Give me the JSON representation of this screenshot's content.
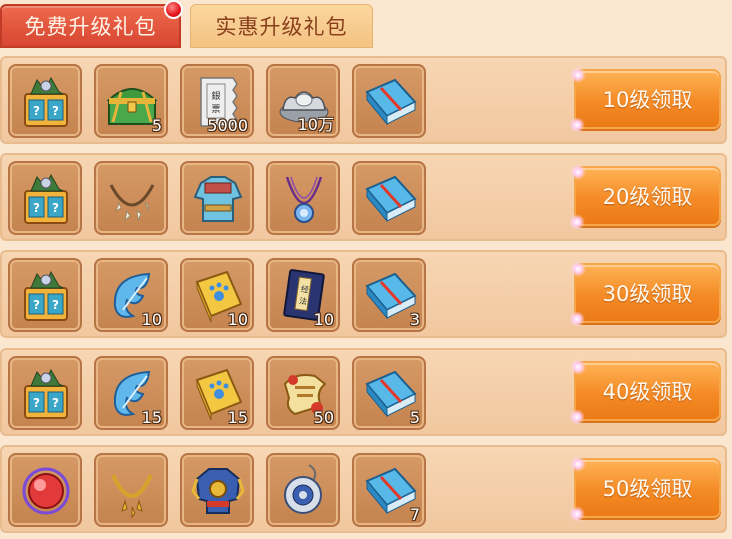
{
  "tabs": {
    "free": "免费升级礼包",
    "discount": "实惠升级礼包"
  },
  "rows": [
    {
      "claim": "10级领取",
      "items": [
        {
          "icon": "mystery-chest-icon",
          "qty": ""
        },
        {
          "icon": "green-treasure-chest-icon",
          "qty": "5"
        },
        {
          "icon": "banknote-icon",
          "qty": "5000"
        },
        {
          "icon": "silver-ingot-icon",
          "qty": "10万"
        },
        {
          "icon": "blue-book-icon",
          "qty": ""
        }
      ]
    },
    {
      "claim": "20级领取",
      "items": [
        {
          "icon": "mystery-chest-icon",
          "qty": ""
        },
        {
          "icon": "tooth-necklace-icon",
          "qty": ""
        },
        {
          "icon": "armor-icon",
          "qty": ""
        },
        {
          "icon": "pendant-icon",
          "qty": ""
        },
        {
          "icon": "blue-book-icon",
          "qty": ""
        }
      ]
    },
    {
      "claim": "30级领取",
      "items": [
        {
          "icon": "mystery-chest-icon",
          "qty": ""
        },
        {
          "icon": "blue-feather-icon",
          "qty": "10"
        },
        {
          "icon": "paw-book-icon",
          "qty": "10"
        },
        {
          "icon": "scripture-book-icon",
          "qty": "10"
        },
        {
          "icon": "blue-book-icon",
          "qty": "3"
        }
      ]
    },
    {
      "claim": "40级领取",
      "items": [
        {
          "icon": "mystery-chest-icon",
          "qty": ""
        },
        {
          "icon": "blue-feather-icon",
          "qty": "15"
        },
        {
          "icon": "paw-book-icon",
          "qty": "15"
        },
        {
          "icon": "scroll-icon",
          "qty": "50"
        },
        {
          "icon": "blue-book-icon",
          "qty": "5"
        }
      ]
    },
    {
      "claim": "50级领取",
      "items": [
        {
          "icon": "red-orb-icon",
          "qty": ""
        },
        {
          "icon": "gold-necklace-icon",
          "qty": ""
        },
        {
          "icon": "ornate-armor-icon",
          "qty": ""
        },
        {
          "icon": "jade-medallion-icon",
          "qty": ""
        },
        {
          "icon": "blue-book-icon",
          "qty": "7"
        }
      ]
    }
  ],
  "colors": {
    "active_tab": "#e0523a",
    "claim_button": "#f48b26",
    "badge": "#e2141a"
  }
}
